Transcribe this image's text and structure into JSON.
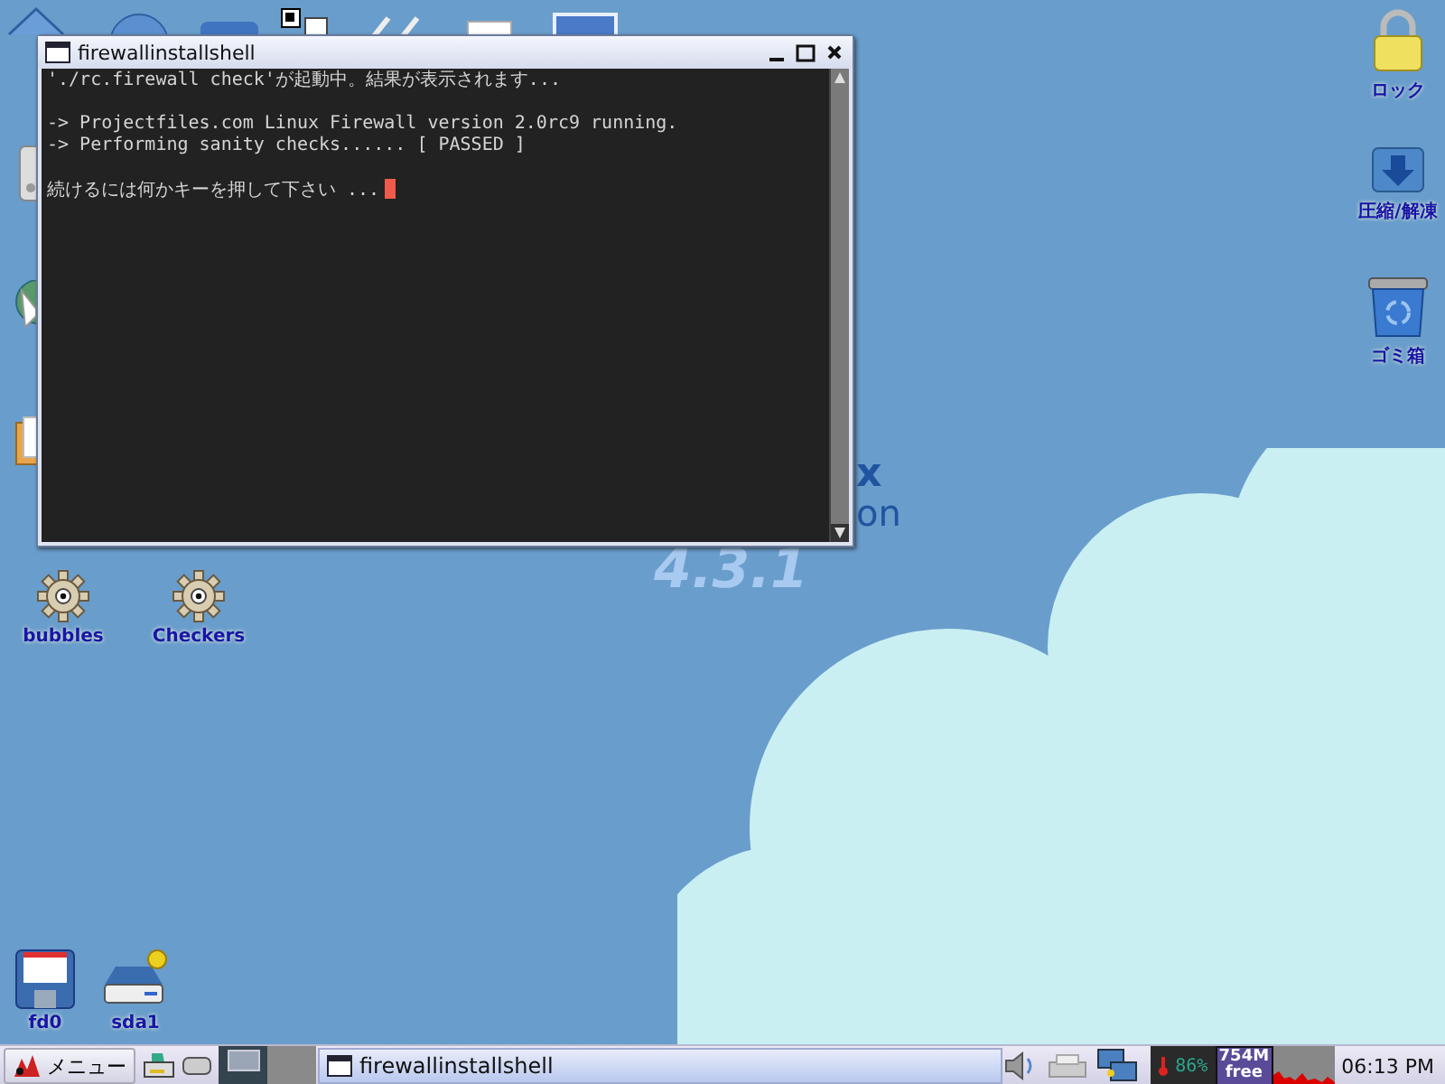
{
  "desktop": {
    "right_icons": [
      {
        "kind": "lock",
        "label": "ロック"
      },
      {
        "kind": "archive",
        "label": "圧縮/解凍"
      },
      {
        "kind": "trash",
        "label": "ゴミ箱"
      }
    ],
    "gear_icons": [
      {
        "kind": "gear",
        "label": "bubbles"
      },
      {
        "kind": "gear",
        "label": "Checkers"
      }
    ],
    "drive_icons": [
      {
        "kind": "floppy",
        "label": "fd0"
      },
      {
        "kind": "drive",
        "label": "sda1"
      }
    ],
    "wallpaper_text": [
      "x",
      "on",
      "4.3.1"
    ]
  },
  "window": {
    "title": "firewallinstallshell",
    "paragraphs": [
      [
        "'./rc.firewall check'が起動中。結果が表示されます..."
      ],
      [
        "-> Projectfiles.com Linux Firewall version 2.0rc9 running.",
        "-> Performing sanity checks...... [ PASSED ]"
      ],
      [
        "続けるには何かキーを押して下さい ..."
      ]
    ],
    "cursor": true
  },
  "taskbar": {
    "menu": "メニュー",
    "desktops": [
      {
        "selected": true
      },
      {
        "selected": false
      }
    ],
    "tasks": [
      {
        "title": "firewallinstallshell"
      }
    ],
    "cpu": "86%",
    "memory": [
      "754M",
      "free"
    ],
    "clock": "06:13 PM"
  }
}
